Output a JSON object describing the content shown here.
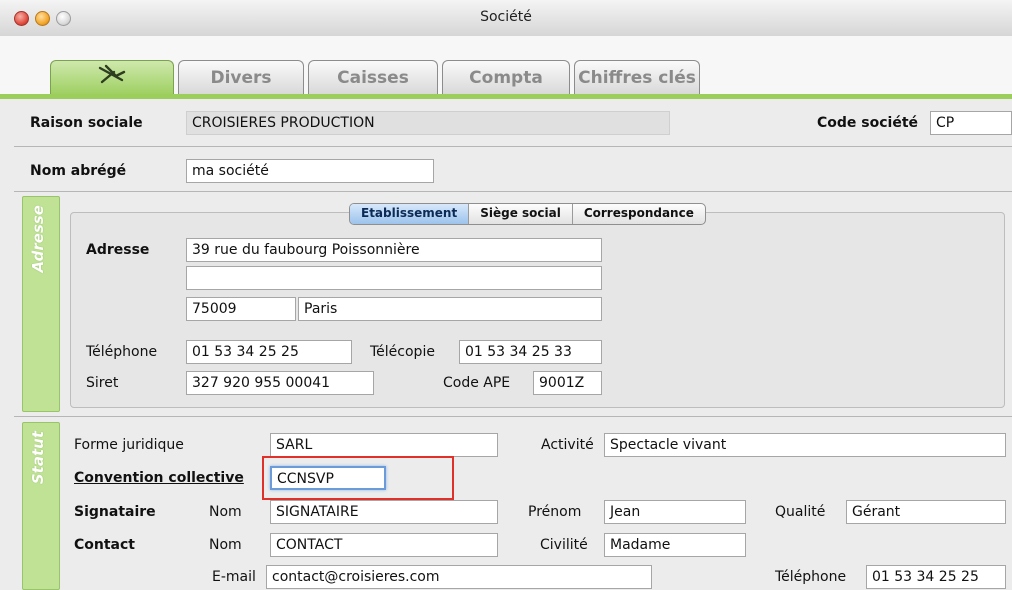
{
  "window": {
    "title": "Société"
  },
  "tabs": [
    {
      "label": "",
      "icon": "flag-icon"
    },
    {
      "label": "Divers"
    },
    {
      "label": "Caisses"
    },
    {
      "label": "Compta"
    },
    {
      "label": "Chiffres clés"
    }
  ],
  "header": {
    "raison_sociale_label": "Raison sociale",
    "raison_sociale_value": "CROISIERES PRODUCTION",
    "code_societe_label": "Code société",
    "code_societe_value": "CP",
    "nom_abrege_label": "Nom abrégé",
    "nom_abrege_value": "ma société"
  },
  "adresse": {
    "side_label": "Adresse",
    "segments": [
      "Etablissement",
      "Siège social",
      "Correspondance"
    ],
    "active_segment": "Etablissement",
    "adresse_label": "Adresse",
    "line1": "39 rue du faubourg Poissonnière",
    "line2": "",
    "postal_code": "75009",
    "city": "Paris",
    "telephone_label": "Téléphone",
    "telephone_value": "01 53 34 25 25",
    "telecopie_label": "Télécopie",
    "telecopie_value": "01 53 34 25 33",
    "siret_label": "Siret",
    "siret_value": "327 920 955 00041",
    "code_ape_label": "Code APE",
    "code_ape_value": "9001Z"
  },
  "statut": {
    "side_label": "Statut",
    "forme_juridique_label": "Forme juridique",
    "forme_juridique_value": "SARL",
    "activite_label": "Activité",
    "activite_value": "Spectacle vivant",
    "convention_label": "Convention collective",
    "convention_value": "CCNSVP",
    "signataire_label": "Signataire",
    "signataire_nom_label": "Nom",
    "signataire_nom_value": "SIGNATAIRE",
    "prenom_label": "Prénom",
    "prenom_value": "Jean",
    "qualite_label": "Qualité",
    "qualite_value": "Gérant",
    "contact_label": "Contact",
    "contact_nom_label": "Nom",
    "contact_nom_value": "CONTACT",
    "civilite_label": "Civilité",
    "civilite_value": "Madame",
    "email_label": "E-mail",
    "email_value": "contact@croisieres.com",
    "contact_tel_label": "Téléphone",
    "contact_tel_value": "01 53 34 25 25"
  },
  "colors": {
    "accent_green": "#9cce5c",
    "highlight_red": "#e0302a"
  }
}
